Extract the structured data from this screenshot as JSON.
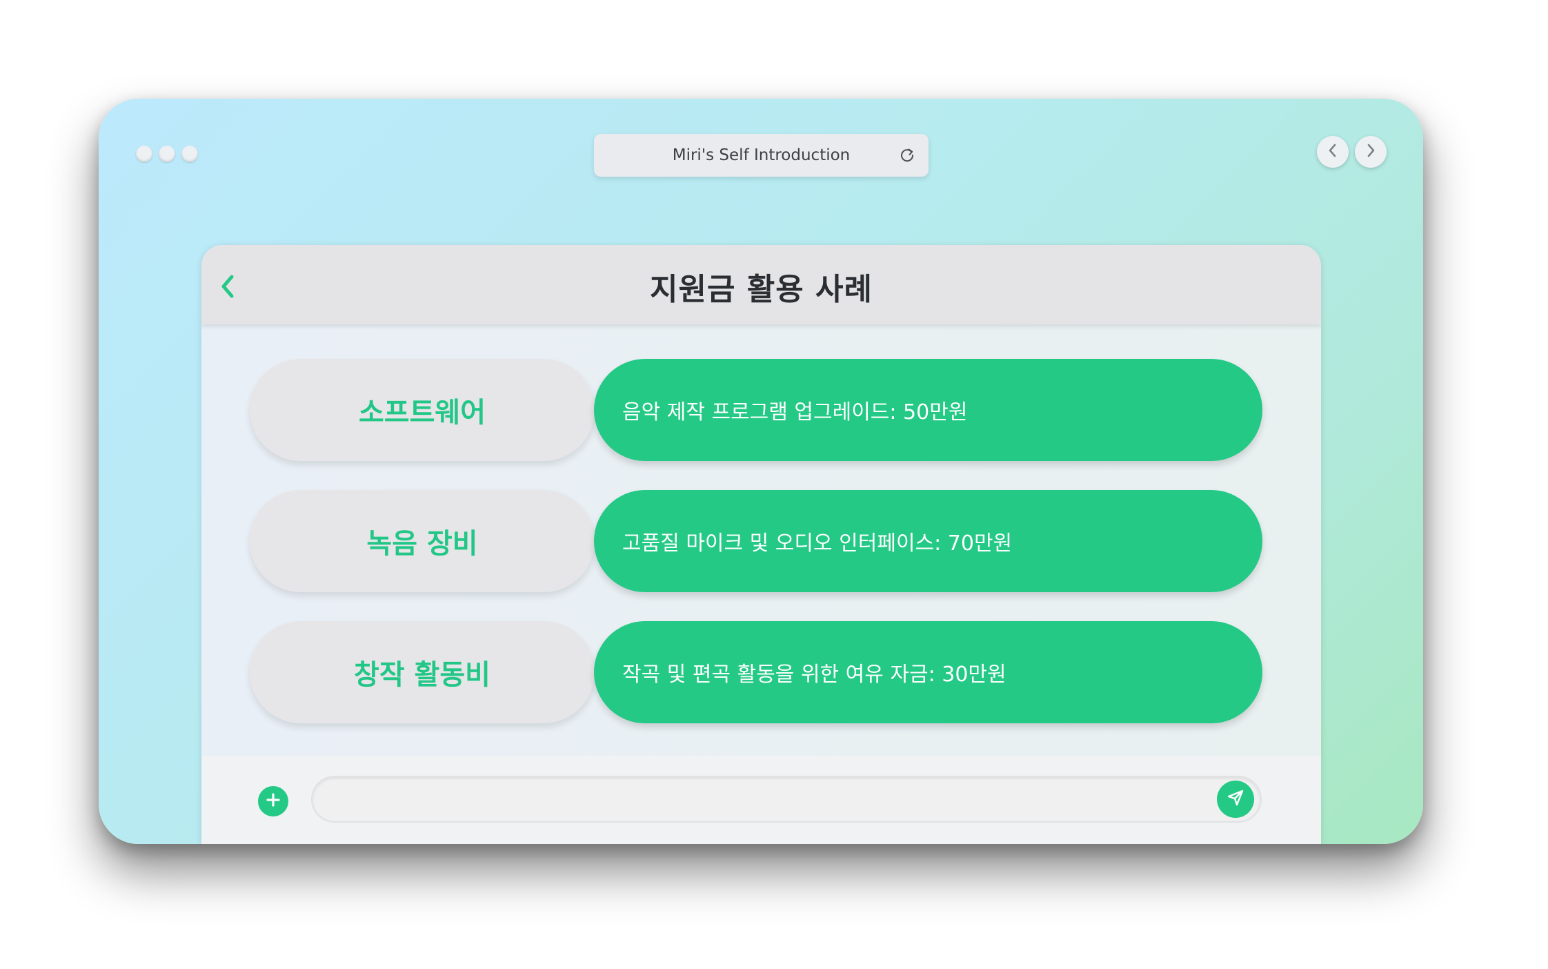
{
  "window": {
    "title": "Miri's Self Introduction"
  },
  "panel": {
    "title": "지원금 활용 사례"
  },
  "items": [
    {
      "label": "소프트웨어",
      "value": "음악 제작 프로그램 업그레이드: 50만원"
    },
    {
      "label": "녹음 장비",
      "value": "고품질 마이크 및 오디오 인터페이스: 70만원"
    },
    {
      "label": "창작 활동비",
      "value": "작곡 및 편곡 활동을 위한 여유 자금: 30만원"
    }
  ],
  "composer": {
    "placeholder": ""
  },
  "colors": {
    "accent": "#23c985",
    "label_bg": "#e6e6e8",
    "header_bg": "#e4e4e6"
  },
  "icons": {
    "reload": "reload-icon",
    "nav_back": "chevron-left-icon",
    "nav_forward": "chevron-right-icon",
    "panel_back": "back-arrow-icon",
    "add": "plus-icon",
    "send": "send-icon"
  }
}
